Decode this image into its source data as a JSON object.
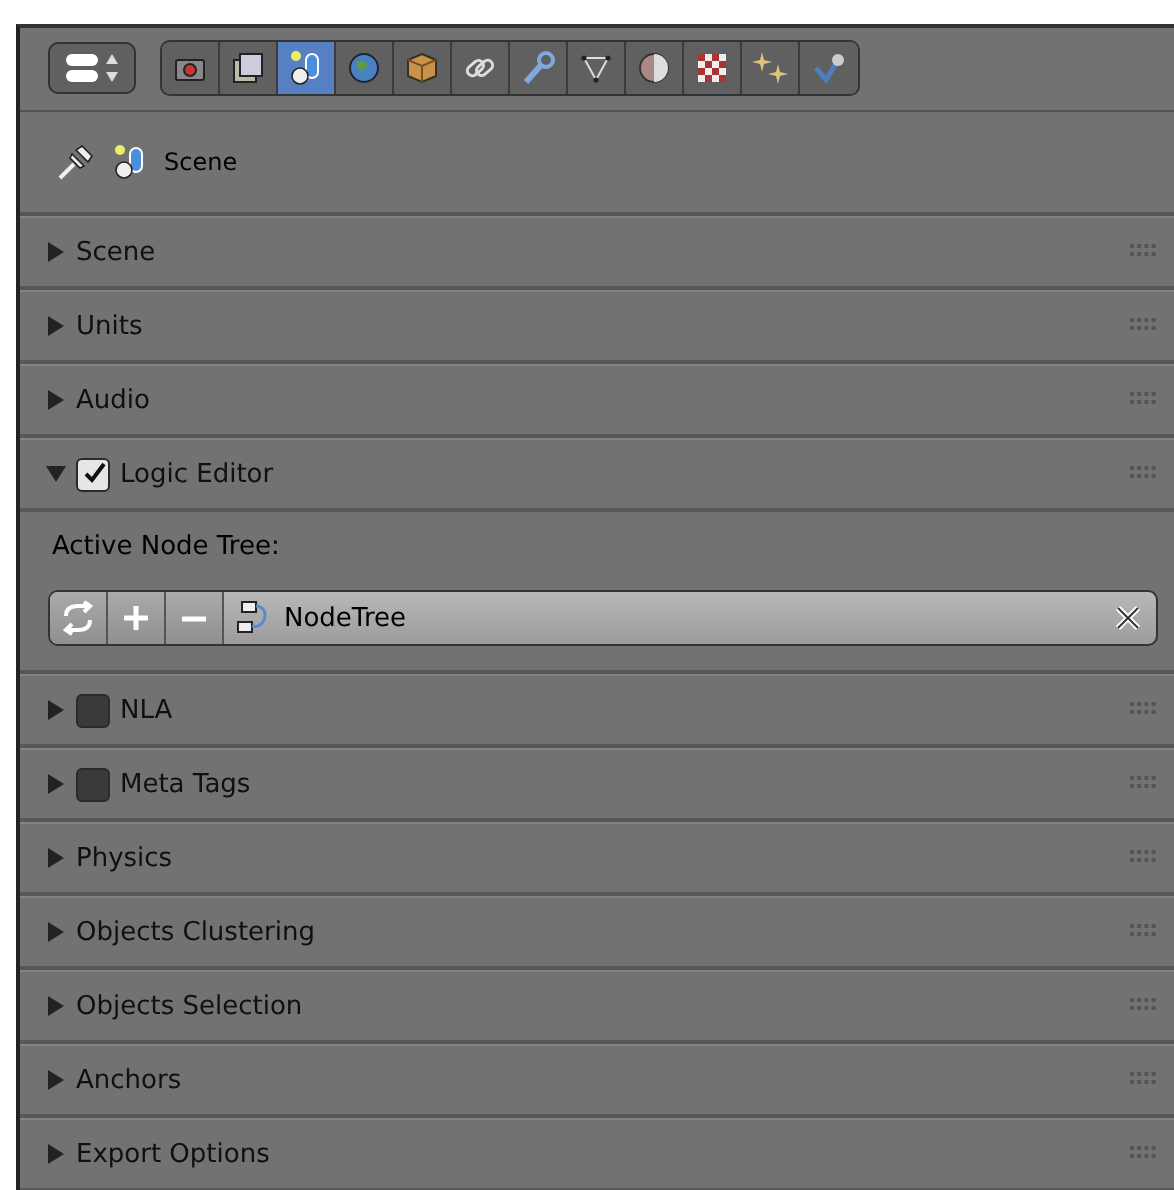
{
  "toolbar": {
    "tabs": [
      {
        "selected": false
      },
      {
        "selected": false
      },
      {
        "selected": true
      },
      {
        "selected": false
      },
      {
        "selected": false
      },
      {
        "selected": false
      },
      {
        "selected": false
      },
      {
        "selected": false
      },
      {
        "selected": false
      },
      {
        "selected": false
      },
      {
        "selected": false
      },
      {
        "selected": false
      }
    ]
  },
  "context": {
    "label": "Scene"
  },
  "panels": [
    {
      "kind": "plain",
      "title": "Scene",
      "expanded": false
    },
    {
      "kind": "plain",
      "title": "Units",
      "expanded": false
    },
    {
      "kind": "plain",
      "title": "Audio",
      "expanded": false
    },
    {
      "kind": "checkbox",
      "title": "Logic Editor",
      "expanded": true,
      "checked": true,
      "content": {
        "label": "Active Node Tree:",
        "node_tree": "NodeTree"
      }
    },
    {
      "kind": "checkbox",
      "title": "NLA",
      "expanded": false,
      "checked": false
    },
    {
      "kind": "checkbox",
      "title": "Meta Tags",
      "expanded": false,
      "checked": false
    },
    {
      "kind": "plain",
      "title": "Physics",
      "expanded": false
    },
    {
      "kind": "plain",
      "title": "Objects Clustering",
      "expanded": false
    },
    {
      "kind": "plain",
      "title": "Objects Selection",
      "expanded": false
    },
    {
      "kind": "plain",
      "title": "Anchors",
      "expanded": false
    },
    {
      "kind": "plain",
      "title": "Export Options",
      "expanded": false
    }
  ]
}
